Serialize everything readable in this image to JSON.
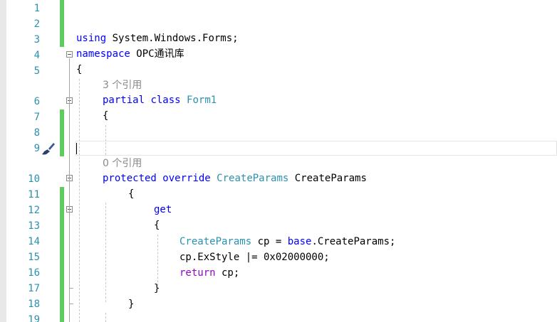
{
  "editor": {
    "line_numbers": [
      "1",
      "2",
      "3",
      "4",
      "5",
      "6",
      "7",
      "8",
      "9",
      "10",
      "11",
      "12",
      "13",
      "14",
      "15",
      "16",
      "17",
      "18",
      "19"
    ],
    "codelens": {
      "form1_refs": "3 个引用",
      "createparams_refs": "0 个引用"
    },
    "code": {
      "l3_using": "using",
      "l3_ns": " System.Windows.Forms;",
      "l4_namespace": "namespace",
      "l4_name_latin": " OPC",
      "l4_name_cjk": "通讯库",
      "l5_brace": "{",
      "l6_partial": "partial",
      "l6_class": "class",
      "l6_name": "Form1",
      "l7_brace": "{",
      "l10_protected": "protected",
      "l10_override": "override",
      "l10_type": "CreateParams",
      "l10_name": " CreateParams",
      "l11_brace": "{",
      "l12_get": "get",
      "l13_brace": "{",
      "l14_type": "CreateParams",
      "l14_var": " cp = ",
      "l14_base": "base",
      "l14_rest": ".CreateParams;",
      "l15_stmt": "cp.ExStyle |= 0x02000000;",
      "l16_return": "return",
      "l16_rest": " cp;",
      "l17_brace": "}",
      "l18_brace": "}"
    },
    "icons": {
      "quick_action": "paintbrush-icon",
      "fold": "collapse-minus-icon"
    },
    "colors": {
      "keyword": "#0000ff",
      "control_keyword": "#8f08c4",
      "type": "#2b91af",
      "line_number": "#2b91af",
      "codelens": "#8a8a8a",
      "change_bar": "#5fcb5f"
    }
  }
}
